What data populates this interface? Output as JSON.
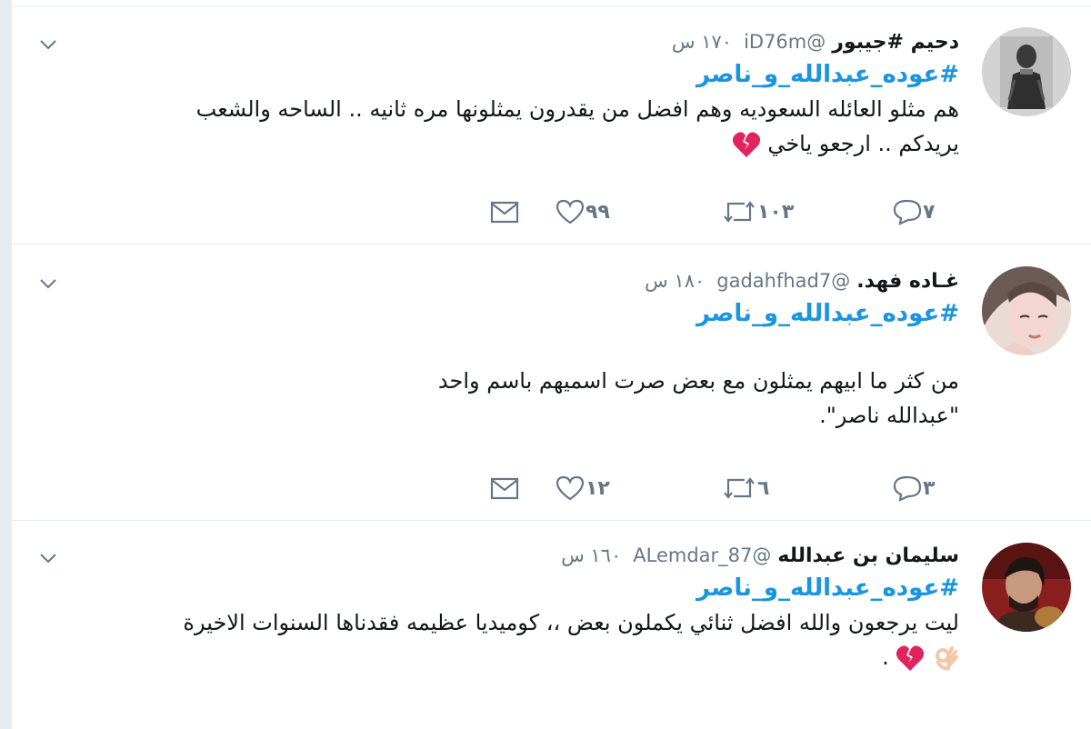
{
  "tweets": [
    {
      "name": "دحيم #جيبور",
      "handle": "@iD76m",
      "time": "١٧٠ س",
      "hashtag": "#عوده_عبدالله_و_ناصر",
      "text_line1": "هم مثلو العائله السعوديه وهم افضل من يقدرون يمثلونها مره ثانيه .. الساحه والشعب",
      "text_line2": "يريدكم .. ارجعو ياخي",
      "emoji": "broken-heart",
      "replies": "٧",
      "retweets": "١٠٣",
      "likes": "٩٩"
    },
    {
      "name": "غـاده فهد.",
      "handle": "@gadahfhad7",
      "time": "١٨٠ س",
      "hashtag": "#عوده_عبدالله_و_ناصر",
      "text_line1": "من كثر ما  ابيهم يمثلون مع بعض صرت اسميهم باسم واحد",
      "text_line2": "\"عبدالله ناصر\".",
      "replies": "٣",
      "retweets": "٦",
      "likes": "١٢"
    },
    {
      "name": "سليمان بن عبدالله",
      "handle": "@ALemdar_87",
      "time": "١٦٠ س",
      "hashtag": "#عوده_عبدالله_و_ناصر",
      "text_line1": "ليت يرجعون والله افضل ثنائي يكملون بعض ،، كوميديا عظيمه فقدناها السنوات الاخيرة",
      "text_line2": ".",
      "emoji": "ok-hand broken-heart"
    }
  ],
  "colors": {
    "link": "#1b95e0",
    "muted": "#657786",
    "text": "#14171a",
    "border": "#e6ecf0",
    "heart_break": "#e0245e"
  }
}
